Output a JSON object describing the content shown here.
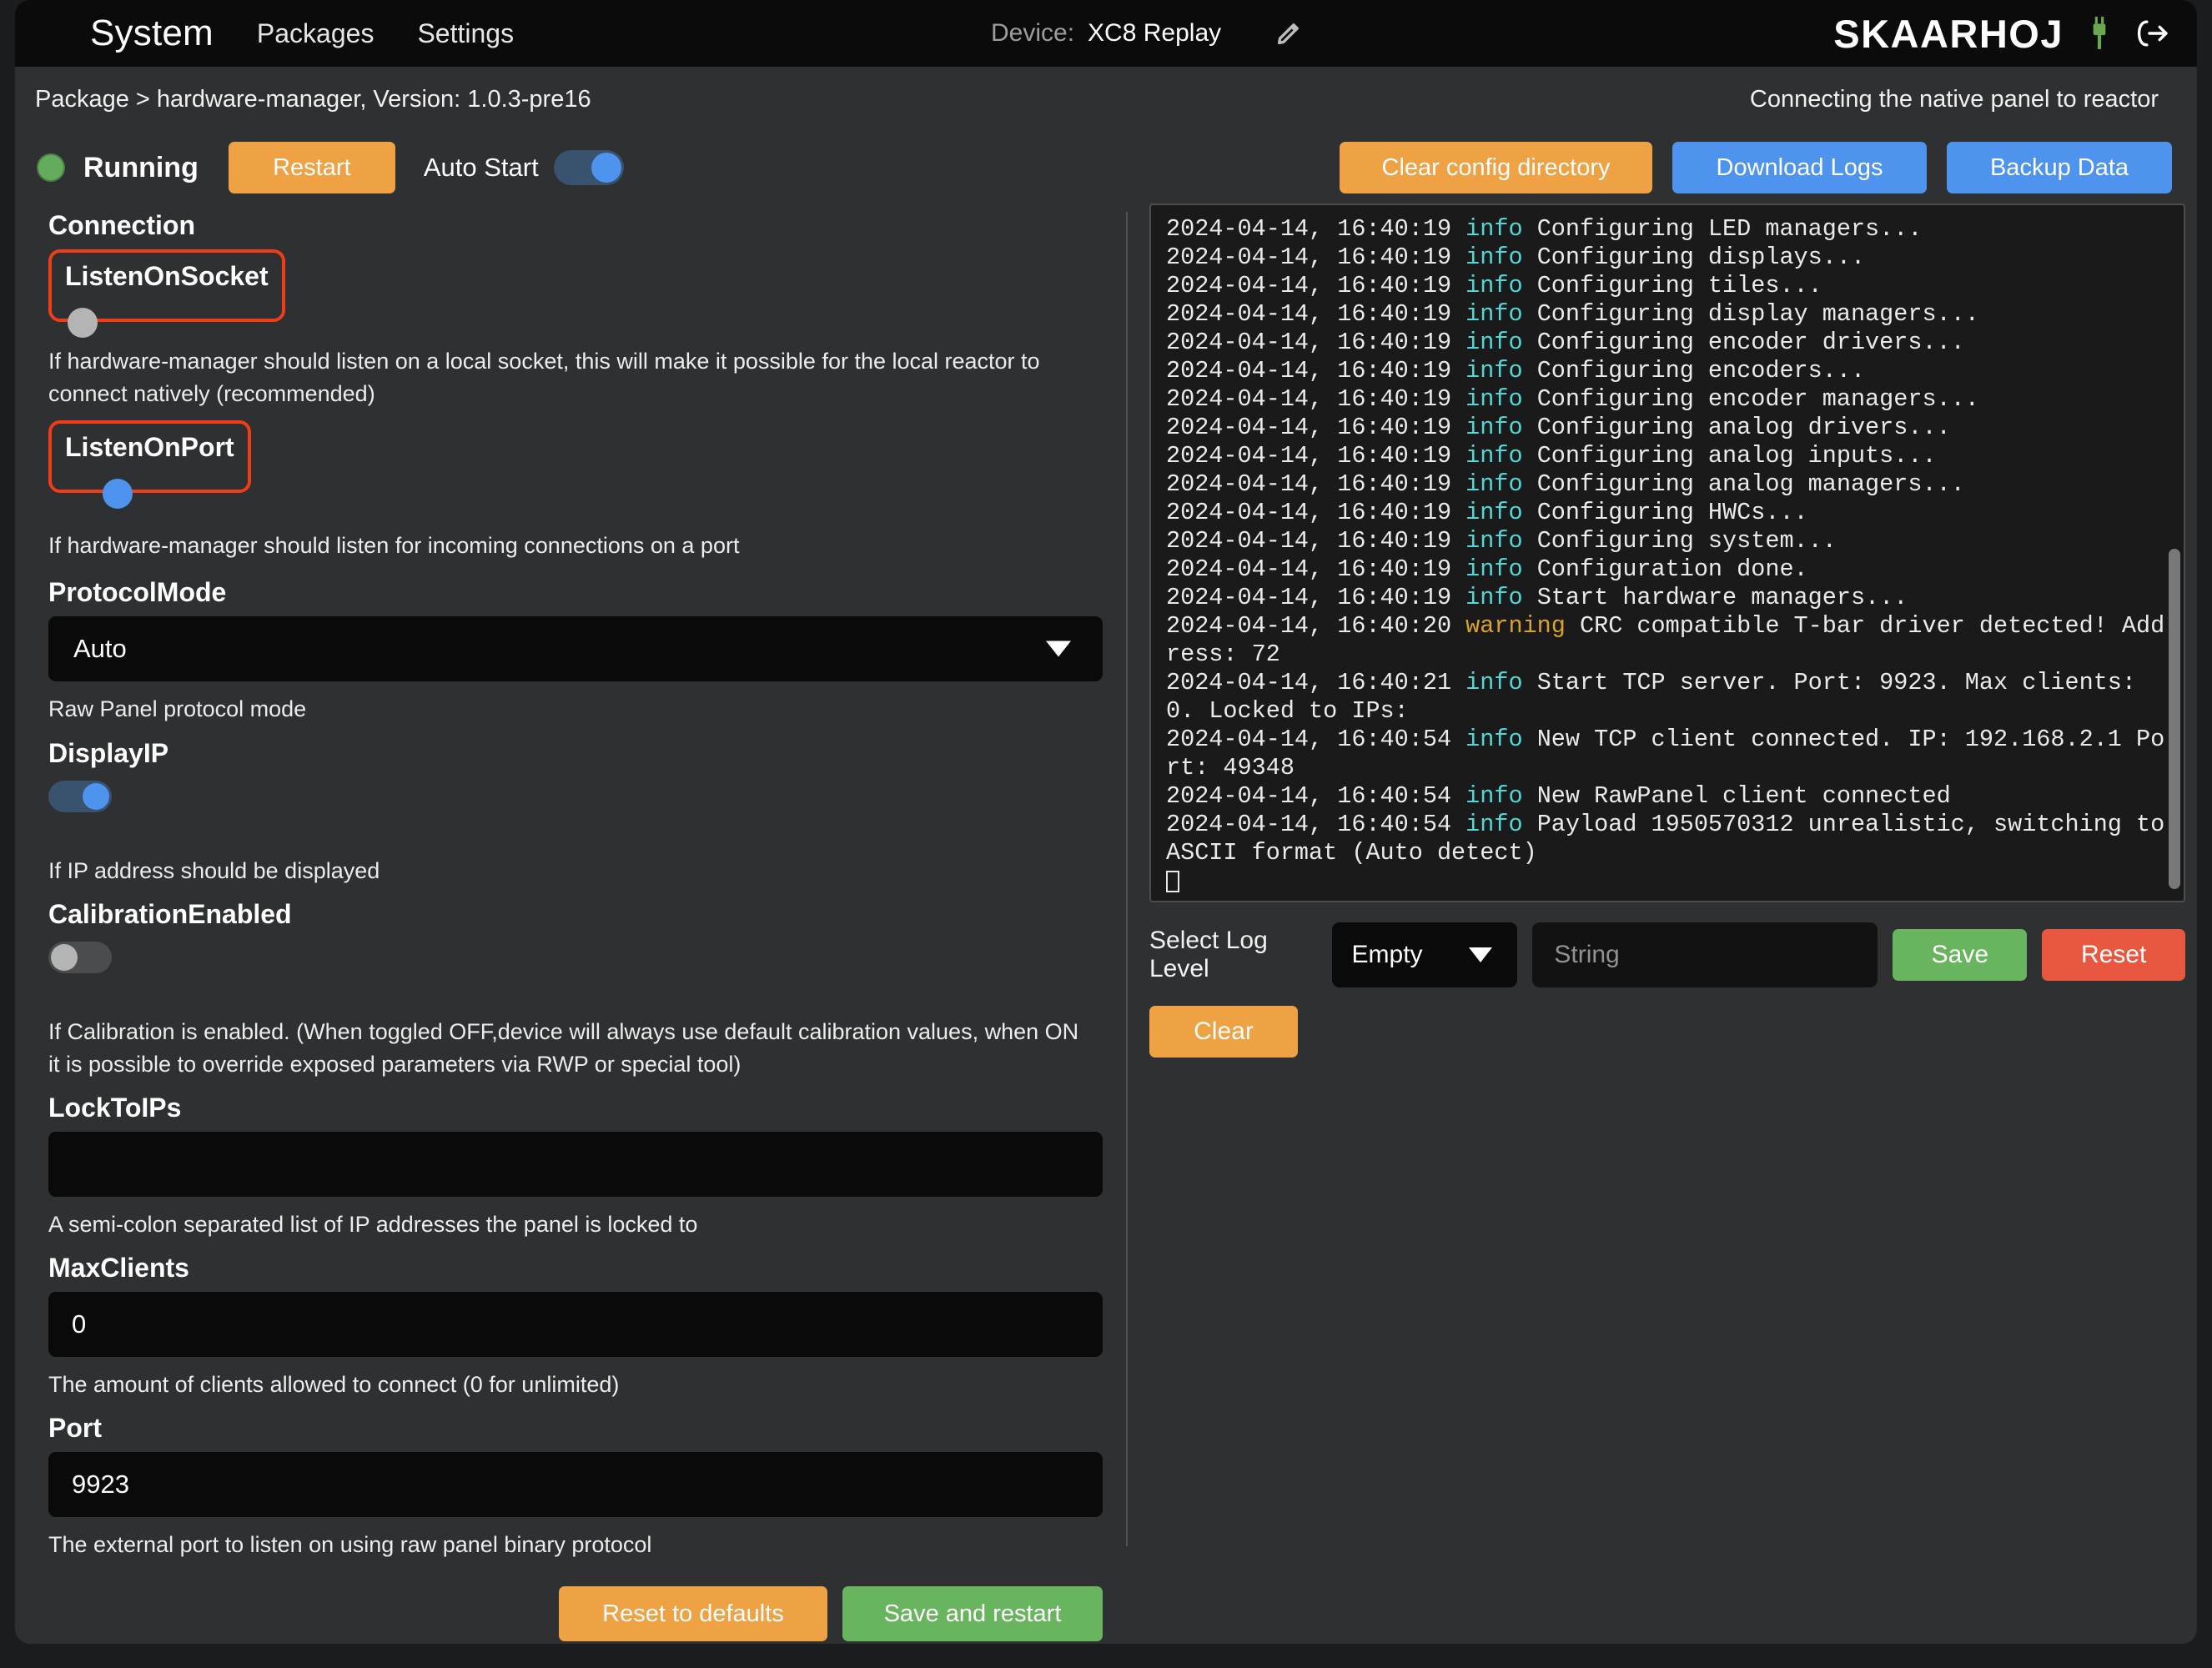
{
  "topbar": {
    "title": "System",
    "links": [
      {
        "label": "Packages"
      },
      {
        "label": "Settings"
      }
    ],
    "device_label": "Device:",
    "device_value": "XC8 Replay",
    "edit_icon": "pencil-icon",
    "brand": "SKAARHOJ",
    "plug_icon": "plug-icon",
    "logout_icon": "logout-icon",
    "colors": {
      "bar_bg": "#0b0b0c",
      "plug_green": "#6aa84f"
    }
  },
  "packagebar": {
    "breadcrumb": "Package > hardware-manager, Version: 1.0.3-pre16",
    "note": "Connecting the native panel to reactor"
  },
  "statusbar": {
    "status_text": "Running",
    "status_color": "#63ac5b",
    "restart_label": "Restart",
    "autostart_label": "Auto Start",
    "autostart_on": true,
    "clear_config_label": "Clear config directory",
    "download_logs_label": "Download Logs",
    "backup_data_label": "Backup Data",
    "colors": {
      "orange": "#efa243",
      "blue": "#4e93ed"
    }
  },
  "form": {
    "section_title": "Connection",
    "highlight_color": "#f03c18",
    "listen_on_socket": {
      "label": "ListenOnSocket",
      "on": false,
      "help": "If hardware-manager should listen on a local socket, this will make it possible for the local reactor to connect natively (recommended)",
      "highlighted": true
    },
    "listen_on_port": {
      "label": "ListenOnPort",
      "on": true,
      "help": "If hardware-manager should listen for incoming connections on a port",
      "highlighted": true
    },
    "protocol_mode": {
      "label": "ProtocolMode",
      "value": "Auto",
      "help": "Raw Panel protocol mode"
    },
    "display_ip": {
      "label": "DisplayIP",
      "on": true,
      "help": "If IP address should be displayed"
    },
    "calibration_enabled": {
      "label": "CalibrationEnabled",
      "on": false,
      "help": "If Calibration is enabled. (When toggled OFF,device will always use default calibration values, when ON it is possible to override exposed parameters via RWP or special tool)"
    },
    "lock_to_ips": {
      "label": "LockToIPs",
      "value": "",
      "placeholder": "",
      "help": "A semi-colon separated list of IP addresses the panel is locked to"
    },
    "max_clients": {
      "label": "MaxClients",
      "value": "0",
      "help": "The amount of clients allowed to connect (0 for unlimited)"
    },
    "port": {
      "label": "Port",
      "value": "9923",
      "help": "The external port to listen on using raw panel binary protocol"
    },
    "reset_defaults_label": "Reset to defaults",
    "save_restart_label": "Save and restart"
  },
  "log": {
    "lines": [
      {
        "time": "2024-04-14, 16:40:19",
        "level": "info",
        "message": "Configuring LED managers..."
      },
      {
        "time": "2024-04-14, 16:40:19",
        "level": "info",
        "message": "Configuring displays..."
      },
      {
        "time": "2024-04-14, 16:40:19",
        "level": "info",
        "message": "Configuring tiles..."
      },
      {
        "time": "2024-04-14, 16:40:19",
        "level": "info",
        "message": "Configuring display managers..."
      },
      {
        "time": "2024-04-14, 16:40:19",
        "level": "info",
        "message": "Configuring encoder drivers..."
      },
      {
        "time": "2024-04-14, 16:40:19",
        "level": "info",
        "message": "Configuring encoders..."
      },
      {
        "time": "2024-04-14, 16:40:19",
        "level": "info",
        "message": "Configuring encoder managers..."
      },
      {
        "time": "2024-04-14, 16:40:19",
        "level": "info",
        "message": "Configuring analog drivers..."
      },
      {
        "time": "2024-04-14, 16:40:19",
        "level": "info",
        "message": "Configuring analog inputs..."
      },
      {
        "time": "2024-04-14, 16:40:19",
        "level": "info",
        "message": "Configuring analog managers..."
      },
      {
        "time": "2024-04-14, 16:40:19",
        "level": "info",
        "message": "Configuring HWCs..."
      },
      {
        "time": "2024-04-14, 16:40:19",
        "level": "info",
        "message": "Configuring system..."
      },
      {
        "time": "2024-04-14, 16:40:19",
        "level": "info",
        "message": "Configuration done."
      },
      {
        "time": "2024-04-14, 16:40:19",
        "level": "info",
        "message": "Start hardware managers..."
      },
      {
        "time": "2024-04-14, 16:40:20",
        "level": "warning",
        "message": "CRC compatible T-bar driver detected! Address: 72"
      },
      {
        "time": "2024-04-14, 16:40:21",
        "level": "info",
        "message": "Start TCP server. Port: 9923. Max clients: 0. Locked to IPs:"
      },
      {
        "time": "2024-04-14, 16:40:54",
        "level": "info",
        "message": "New TCP client connected. IP: 192.168.2.1 Port: 49348"
      },
      {
        "time": "2024-04-14, 16:40:54",
        "level": "info",
        "message": "New RawPanel client connected"
      },
      {
        "time": "2024-04-14, 16:40:54",
        "level": "info",
        "message": "Payload 1950570312 unrealistic, switching to ASCII format (Auto detect)"
      }
    ],
    "colors": {
      "info": "#4fd8d8",
      "warning": "#d9a22a",
      "text": "#eaeaea",
      "bg": "#1a1a1a"
    },
    "controls": {
      "level_label": "Select Log Level",
      "level_value": "Empty",
      "filter_placeholder": "String",
      "filter_value": "",
      "save_label": "Save",
      "reset_label": "Reset",
      "clear_label": "Clear"
    }
  }
}
